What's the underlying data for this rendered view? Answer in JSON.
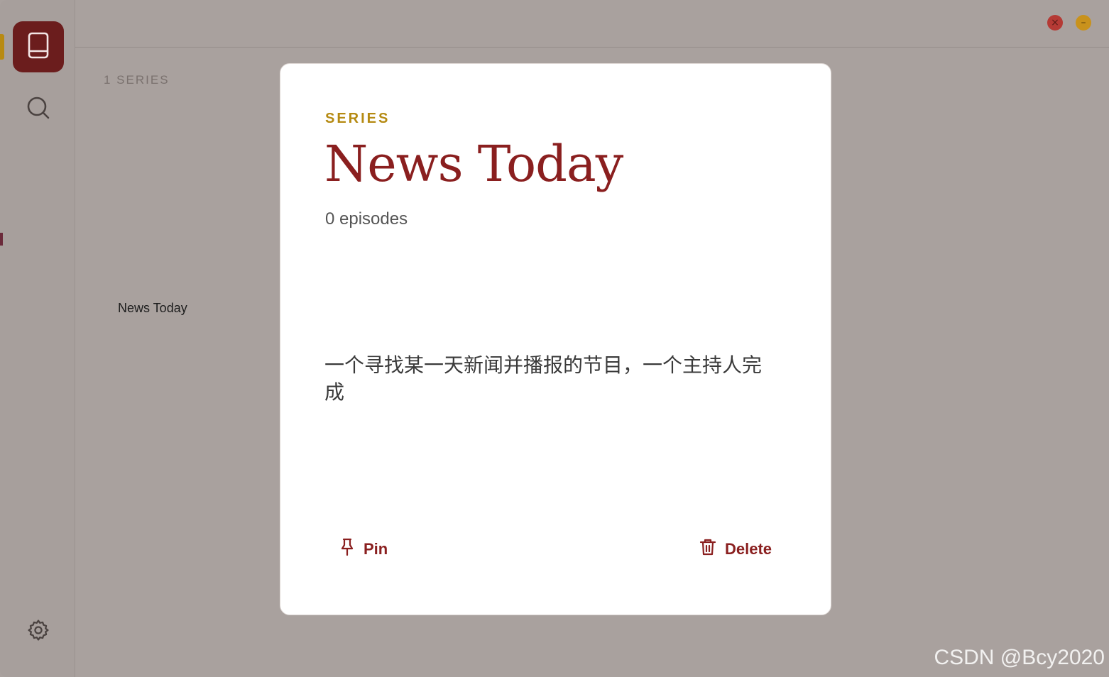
{
  "window": {
    "close_glyph": "×",
    "minimize_glyph": "–"
  },
  "rail": {
    "items": [
      {
        "name": "library",
        "icon": "book-icon",
        "active": true
      },
      {
        "name": "search",
        "icon": "search-icon",
        "active": false
      },
      {
        "name": "settings",
        "icon": "gear-icon",
        "active": false
      }
    ]
  },
  "library": {
    "count_label": "1 SERIES",
    "items": [
      {
        "label": "News Today"
      }
    ]
  },
  "modal": {
    "eyebrow": "SERIES",
    "title": "News Today",
    "episodes": "0 episodes",
    "description": "一个寻找某一天新闻并播报的节目，一个主持人完成",
    "pin_label": "Pin",
    "delete_label": "Delete"
  },
  "watermark": "CSDN @Bcy2020",
  "colors": {
    "accent": "#8a1f1f",
    "gold": "#b58a12",
    "overlay_bg": "#a9a19e",
    "active_rail": "#6b1d1d"
  }
}
